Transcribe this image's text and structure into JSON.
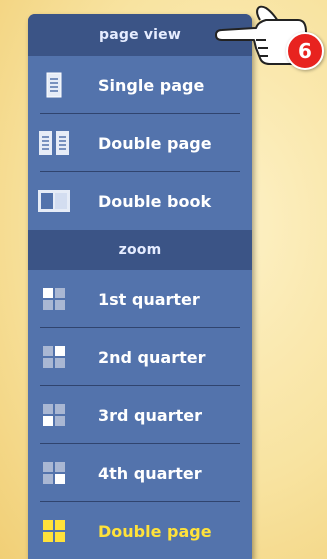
{
  "panel": {
    "page_view_header": "page view",
    "zoom_header": "zoom",
    "page_view_items": [
      {
        "label": "Single page",
        "icon": "single-page-icon"
      },
      {
        "label": "Double page",
        "icon": "double-page-icon"
      },
      {
        "label": "Double book",
        "icon": "double-book-icon"
      }
    ],
    "zoom_items": [
      {
        "label": "1st quarter",
        "icon": "quarter-tl-icon"
      },
      {
        "label": "2nd quarter",
        "icon": "quarter-tr-icon"
      },
      {
        "label": "3rd quarter",
        "icon": "quarter-bl-icon"
      },
      {
        "label": "4th quarter",
        "icon": "quarter-br-icon"
      },
      {
        "label": "Double page",
        "icon": "full-grid-icon"
      }
    ]
  },
  "callout": {
    "number": "6",
    "icon": "pointing-hand-icon"
  },
  "colors": {
    "panel": "#5373ac",
    "header": "#3b5486",
    "highlight": "#ffe23a",
    "badge": "#e8231f"
  }
}
